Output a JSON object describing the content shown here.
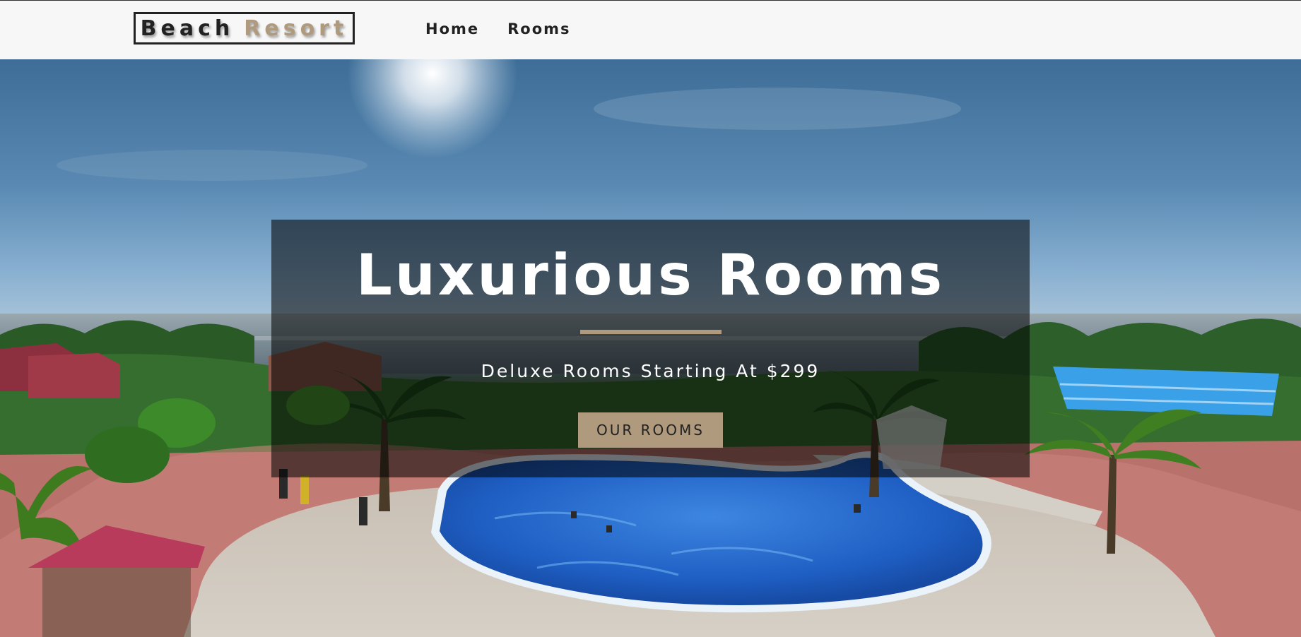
{
  "navbar": {
    "logo": {
      "word1": "Beach",
      "word2": "Resort"
    },
    "links": [
      {
        "label": "Home"
      },
      {
        "label": "Rooms"
      }
    ]
  },
  "hero": {
    "title": "Luxurious Rooms",
    "subtitle": "Deluxe Rooms Starting At $299",
    "button_label": "OUR ROOMS"
  },
  "colors": {
    "accent": "#af9a7d",
    "text_dark": "#222222",
    "nav_background": "#f7f7f7",
    "banner_overlay": "rgba(0,0,0,0.55)"
  }
}
